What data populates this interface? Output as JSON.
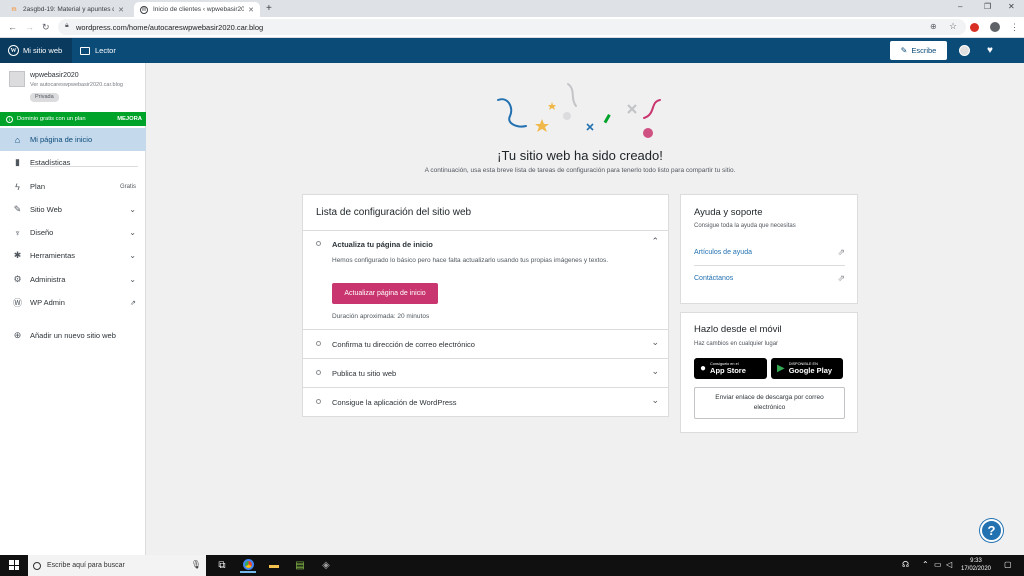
{
  "browser": {
    "tabs": [
      {
        "title": "2asgbd-19: Material y apuntes d",
        "active": false
      },
      {
        "title": "Inicio de clientes ‹ wpwebasir20",
        "active": true
      }
    ],
    "new_tab": "+",
    "url": "wordpress.com/home/autocareswpwebasir2020.car.blog",
    "window_controls": {
      "minimize": "–",
      "maximize": "❐",
      "close": "✕"
    }
  },
  "masterbar": {
    "my_site": "Mi sitio web",
    "reader": "Lector",
    "write": "Escribe"
  },
  "sidebar": {
    "site_name": "wpwebasir2020",
    "site_url": "Ver autocareswpwebasir2020.car.blog",
    "privacy_badge": "Privada",
    "domain_promo": "Dominio gratis con un plan",
    "domain_upgrade": "MEJORA",
    "items": [
      {
        "label": "Mi página de inicio",
        "icon": "home-icon",
        "active": true
      },
      {
        "label": "Estadísticas",
        "icon": "stats-icon"
      },
      {
        "label": "Plan",
        "icon": "plan-icon",
        "badge": "Gratis"
      },
      {
        "label": "Sitio Web",
        "icon": "pencil-icon",
        "chevron": true
      },
      {
        "label": "Diseño",
        "icon": "brush-icon",
        "chevron": true
      },
      {
        "label": "Herramientas",
        "icon": "wrench-icon",
        "chevron": true
      },
      {
        "label": "Administra",
        "icon": "gear-icon",
        "chevron": true
      },
      {
        "label": "WP Admin",
        "icon": "wordpress-icon",
        "external": true
      },
      {
        "label": "Añadir un nuevo sitio web",
        "icon": "plus-circle-icon"
      }
    ]
  },
  "hero": {
    "title": "¡Tu sitio web ha sido creado!",
    "subtitle": "A continuación, usa esta breve lista de tareas de configuración para tenerlo todo listo para compartir tu sitio."
  },
  "checklist": {
    "title": "Lista de configuración del sitio web",
    "tasks": [
      {
        "title": "Actualiza tu página de inicio",
        "description": "Hemos configurado lo básico pero hace falta actualizarlo usando tus propias imágenes y textos.",
        "button": "Actualizar página de inicio",
        "duration": "Duración aproximada: 20 minutos",
        "expanded": true
      },
      {
        "title": "Confirma tu dirección de correo electrónico"
      },
      {
        "title": "Publica tu sitio web"
      },
      {
        "title": "Consigue la aplicación de WordPress"
      }
    ]
  },
  "help_card": {
    "title": "Ayuda y soporte",
    "subtitle": "Consigue toda la ayuda que necesitas",
    "links": [
      "Artículos de ayuda",
      "Contáctanos"
    ]
  },
  "mobile_card": {
    "title": "Hazlo desde el móvil",
    "subtitle": "Haz cambios en cualquier lugar",
    "appstore_small": "Consíguelo en el",
    "appstore_big": "App Store",
    "googleplay_small": "DISPONIBLE EN",
    "googleplay_big": "Google Play",
    "email_button": "Enviar enlace de descarga por correo electrónico"
  },
  "taskbar": {
    "search_placeholder": "Escribe aquí para buscar",
    "time": "9:33",
    "date": "17/02/2020"
  },
  "colors": {
    "masterbar": "#0a4b78",
    "accent_pink": "#c9356e",
    "domain_green": "#00a32a",
    "active_item": "#c5d9ed"
  }
}
